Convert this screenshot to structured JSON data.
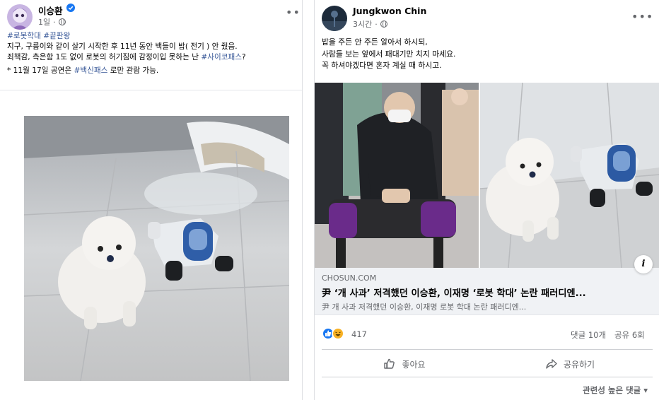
{
  "left_post": {
    "author": "이승환",
    "time": "1일",
    "verified": true,
    "lines": [
      {
        "tags": "#로봇학대 #끝판왕"
      },
      {
        "text": "지구, 구름이와 같이 살기 시작한 후 11년 동안 백들이 밥( 전기 ) 안 줬음."
      },
      {
        "before": "죄책감, 측은함 1도 없이 로봇의 허기짐에 감정이입 못하는 난 ",
        "tag": "#사이코패스",
        "after": "?"
      },
      {
        "before": "* 11월 17일 공연은 ",
        "tag": "#백신패스",
        "after": " 로만 관람 가능."
      }
    ]
  },
  "right_post": {
    "author": "Jungkwon Chin",
    "time": "3시간",
    "lines": [
      "밥을 주든 안 주든 알아서 하시되,",
      "사람들 보는 앞에서 패대기만 치지 마세요.",
      "꼭 하셔야겠다면 혼자 계실 때 하시고."
    ],
    "link": {
      "domain": "CHOSUN.COM",
      "title": "尹 ‘개 사과’ 저격했던 이승환, 이재명 ‘로봇 학대’ 논란 패러디엔...",
      "description": "尹 개 사과 저격했던 이승환, 이재명 로봇 학대 논란 패러디엔...",
      "info_icon": "i"
    },
    "reactions_count": "417",
    "comments": "댓글 10개",
    "shares": "공유 6회",
    "like_label": "좋아요",
    "share_label": "공유하기",
    "relevant_comments": "관련성 높은 댓글 ▾"
  },
  "colors": {
    "link_blue": "#385898",
    "like_blue": "#1877f2",
    "muted": "#65676b"
  },
  "icons": [
    "more-icon",
    "globe-icon",
    "verified-badge-icon",
    "like-reaction-icon",
    "haha-reaction-icon",
    "thumbs-up-icon",
    "share-arrow-icon",
    "info-icon"
  ]
}
